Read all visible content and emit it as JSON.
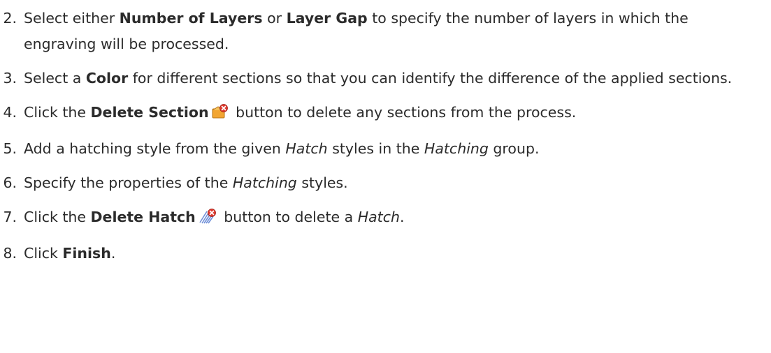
{
  "steps": [
    {
      "num": "2.",
      "parts": [
        {
          "t": "Select either "
        },
        {
          "t": "Number of Layers",
          "s": "b"
        },
        {
          "t": " or "
        },
        {
          "t": "Layer Gap",
          "s": "b"
        },
        {
          "t": " to specify the number of layers in which the engraving will be processed."
        }
      ]
    },
    {
      "num": "3.",
      "parts": [
        {
          "t": "Select a "
        },
        {
          "t": "Color",
          "s": "b"
        },
        {
          "t": " for different sections so that you can identify the difference of the applied sections."
        }
      ]
    },
    {
      "num": "4.",
      "parts": [
        {
          "t": "Click the "
        },
        {
          "t": "Delete Section",
          "s": "b"
        },
        {
          "icon": "delete-section-icon"
        },
        {
          "t": " button to delete any sections from the process."
        }
      ]
    },
    {
      "num": "5.",
      "parts": [
        {
          "t": "Add a hatching style from the given "
        },
        {
          "t": "Hatch",
          "s": "i"
        },
        {
          "t": " styles in the "
        },
        {
          "t": "Hatching",
          "s": "i"
        },
        {
          "t": " group."
        }
      ]
    },
    {
      "num": "6.",
      "parts": [
        {
          "t": "Specify the properties of the "
        },
        {
          "t": "Hatching",
          "s": "i"
        },
        {
          "t": " styles."
        }
      ]
    },
    {
      "num": "7.",
      "parts": [
        {
          "t": "Click the "
        },
        {
          "t": "Delete Hatch",
          "s": "b"
        },
        {
          "icon": "delete-hatch-icon"
        },
        {
          "t": " button to delete a "
        },
        {
          "t": "Hatch",
          "s": "i"
        },
        {
          "t": "."
        }
      ]
    },
    {
      "num": "8.",
      "parts": [
        {
          "t": "Click "
        },
        {
          "t": "Finish",
          "s": "b"
        },
        {
          "t": "."
        }
      ]
    }
  ]
}
